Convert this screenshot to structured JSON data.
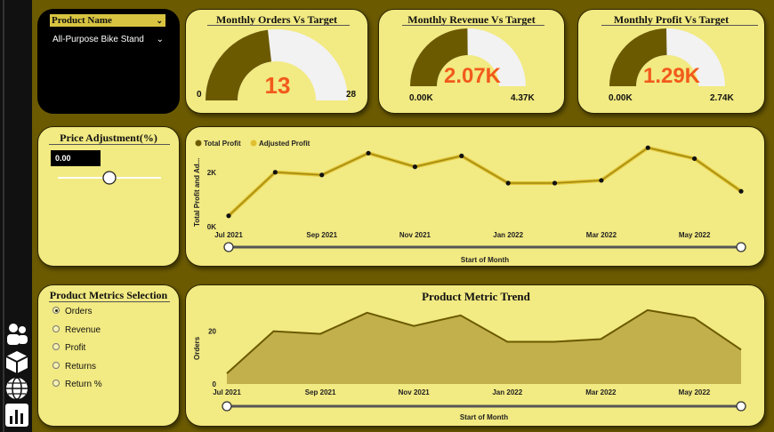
{
  "slicer": {
    "label": "Product Name",
    "selected": "All-Purpose Bike Stand"
  },
  "gauges": [
    {
      "title": "Monthly Orders Vs Target",
      "value": "13",
      "min": "0",
      "max": "28",
      "fraction": 0.464
    },
    {
      "title": "Monthly Revenue Vs Target",
      "value": "2.07K",
      "min": "0.00K",
      "max": "4.37K",
      "fraction": 0.474
    },
    {
      "title": "Monthly Profit Vs Target",
      "value": "1.29K",
      "min": "0.00K",
      "max": "2.74K",
      "fraction": 0.471
    }
  ],
  "price_adjustment": {
    "title": "Price Adjustment(%)",
    "value": "0.00",
    "slider_fraction": 0.5
  },
  "metrics_selection": {
    "title": "Product Metrics Selection",
    "options": [
      "Orders",
      "Revenue",
      "Profit",
      "Returns",
      "Return %"
    ],
    "selected": "Orders"
  },
  "colors": {
    "dark_gold": "#6b5a00",
    "card_bg": "#f2ea82",
    "gauge_track": "#f2f2f2",
    "accent": "#f25a1c",
    "adjusted": "#e0c030"
  },
  "chart_data": [
    {
      "type": "line",
      "legend": [
        "Total Profit",
        "Adjusted Profit"
      ],
      "x": [
        "Jul 2021",
        "Aug 2021",
        "Sep 2021",
        "Oct 2021",
        "Nov 2021",
        "Dec 2021",
        "Jan 2022",
        "Feb 2022",
        "Mar 2022",
        "Apr 2022",
        "May 2022",
        "Jun 2022"
      ],
      "x_tick_labels": [
        "Jul 2021",
        "Sep 2021",
        "Nov 2021",
        "Jan 2022",
        "Mar 2022",
        "May 2022"
      ],
      "series": [
        {
          "name": "Total Profit",
          "values": [
            0.4,
            2.0,
            1.9,
            2.7,
            2.2,
            2.6,
            1.6,
            1.6,
            1.7,
            2.9,
            2.5,
            1.3
          ]
        },
        {
          "name": "Adjusted Profit",
          "values": [
            0.4,
            2.0,
            1.9,
            2.7,
            2.2,
            2.6,
            1.6,
            1.6,
            1.7,
            2.9,
            2.5,
            1.3
          ]
        }
      ],
      "xlabel": "Start of Month",
      "ylabel": "Total Profit and Ad...",
      "y_tick_labels": [
        "0K",
        "2K"
      ],
      "ylim": [
        0,
        3.2
      ]
    },
    {
      "type": "area",
      "title": "Product Metric Trend",
      "x": [
        "Jul 2021",
        "Aug 2021",
        "Sep 2021",
        "Oct 2021",
        "Nov 2021",
        "Dec 2021",
        "Jan 2022",
        "Feb 2022",
        "Mar 2022",
        "Apr 2022",
        "May 2022",
        "Jun 2022"
      ],
      "x_tick_labels": [
        "Jul 2021",
        "Sep 2021",
        "Nov 2021",
        "Jan 2022",
        "Mar 2022",
        "May 2022"
      ],
      "series": [
        {
          "name": "Orders",
          "values": [
            4,
            20,
            19,
            27,
            22,
            26,
            16,
            16,
            17,
            28,
            25,
            13
          ]
        }
      ],
      "xlabel": "Start of Month",
      "ylabel": "Orders",
      "y_tick_labels": [
        "0",
        "20"
      ],
      "ylim": [
        0,
        32
      ]
    }
  ]
}
